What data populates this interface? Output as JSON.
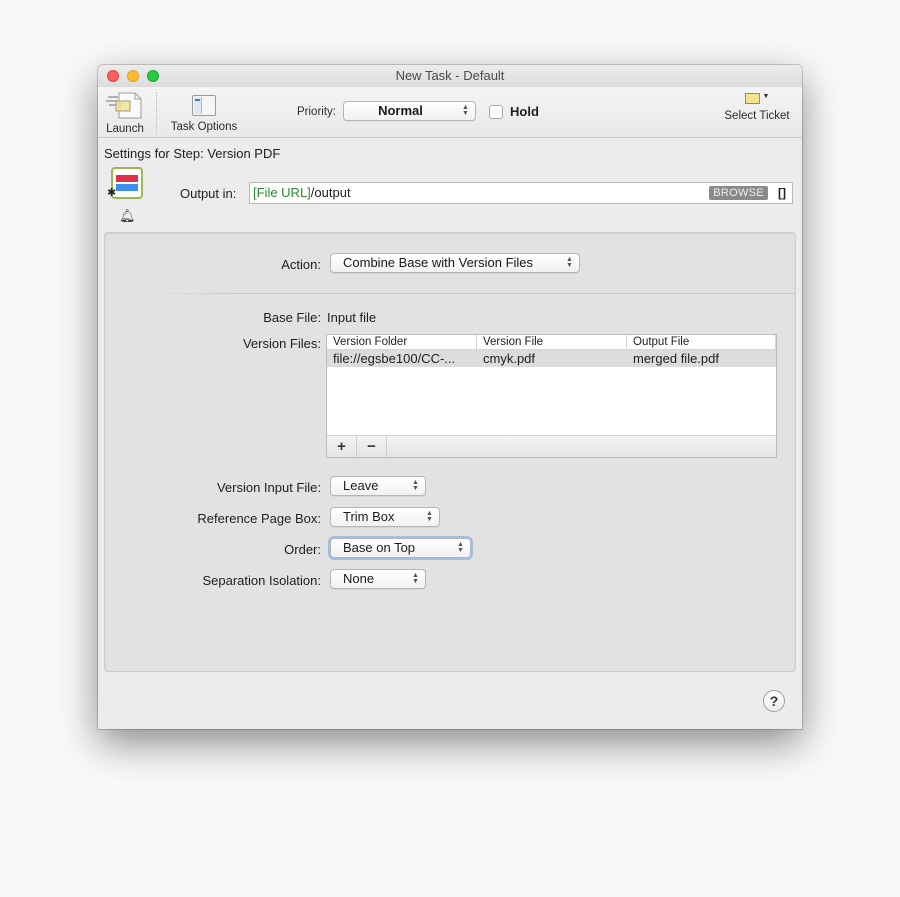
{
  "window": {
    "title": "New Task - Default"
  },
  "toolbar": {
    "launch_label": "Launch",
    "task_options_label": "Task Options",
    "priority_label": "Priority:",
    "priority_value": "Normal",
    "hold_label": "Hold",
    "hold_checked": false,
    "select_ticket_label": "Select Ticket"
  },
  "step": {
    "title": "Settings for Step: Version PDF",
    "output_label": "Output in:",
    "output_token": "[File URL]",
    "output_path": "/output",
    "browse_label": "BROWSE",
    "bracket_label": "[]"
  },
  "form": {
    "action_label": "Action:",
    "action_value": "Combine Base with Version Files",
    "base_file_label": "Base File:",
    "base_file_value": "Input file",
    "version_files_label": "Version Files:",
    "table": {
      "columns": [
        "Version Folder",
        "Version File",
        "Output File"
      ],
      "rows": [
        [
          "file://egsbe100/CC-...",
          "cmyk.pdf",
          "merged file.pdf"
        ]
      ],
      "add_label": "+",
      "remove_label": "−"
    },
    "version_input_file_label": "Version Input File:",
    "version_input_file_value": "Leave",
    "reference_page_box_label": "Reference Page Box:",
    "reference_page_box_value": "Trim Box",
    "order_label": "Order:",
    "order_value": "Base on Top",
    "separation_isolation_label": "Separation Isolation:",
    "separation_isolation_value": "None"
  },
  "help_label": "?"
}
